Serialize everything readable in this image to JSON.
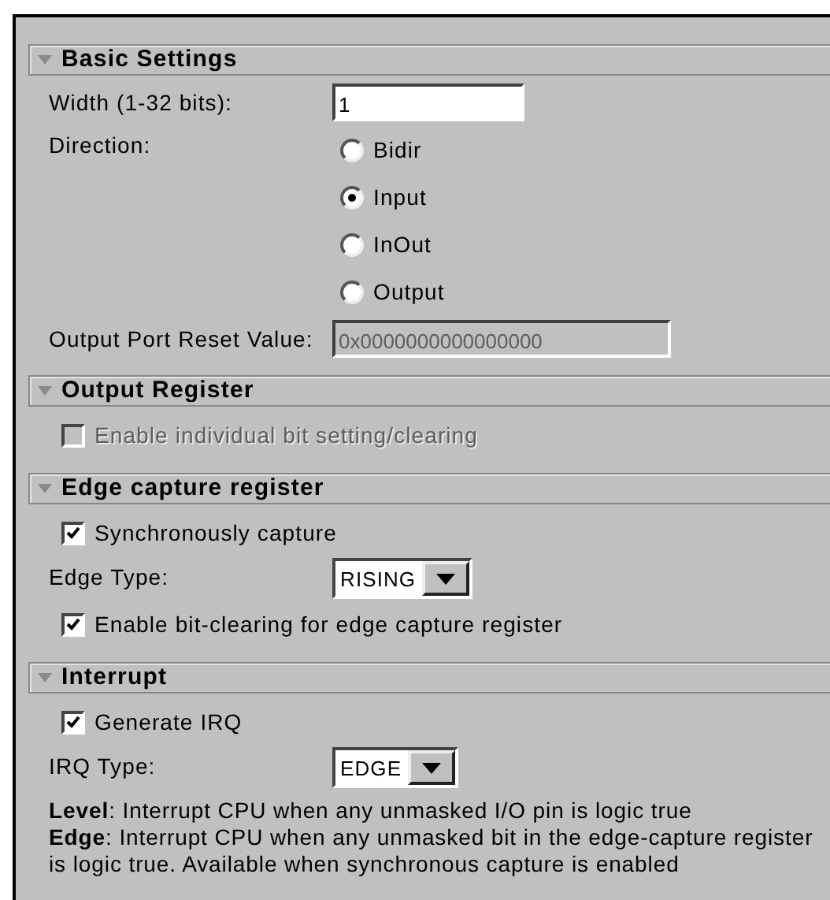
{
  "sections": [
    {
      "title": "Basic Settings",
      "expanded": true,
      "rows": [
        {
          "kind": "text",
          "label": "Width (1-32 bits):",
          "value": "1",
          "disabled": false
        },
        {
          "kind": "radio",
          "label": "Direction:",
          "options": [
            {
              "label": "Bidir",
              "selected": false
            },
            {
              "label": "Input",
              "selected": true
            },
            {
              "label": "InOut",
              "selected": false
            },
            {
              "label": "Output",
              "selected": false
            }
          ]
        },
        {
          "kind": "text",
          "label": "Output Port Reset Value:",
          "value": "0x0000000000000000",
          "disabled": true
        }
      ]
    },
    {
      "title": "Output Register",
      "expanded": true,
      "rows": [
        {
          "kind": "checkbox",
          "label": "Enable individual bit setting/clearing",
          "checked": false,
          "disabled": true
        }
      ]
    },
    {
      "title": "Edge capture register",
      "expanded": true,
      "rows": [
        {
          "kind": "checkbox",
          "label": "Synchronously capture",
          "checked": true,
          "disabled": false
        },
        {
          "kind": "select",
          "label": "Edge Type:",
          "value": "RISING"
        },
        {
          "kind": "checkbox",
          "label": "Enable bit-clearing for edge capture register",
          "checked": true,
          "disabled": false
        }
      ]
    },
    {
      "title": "Interrupt",
      "expanded": true,
      "rows": [
        {
          "kind": "checkbox",
          "label": "Generate IRQ",
          "checked": true,
          "disabled": false
        },
        {
          "kind": "select",
          "label": "IRQ Type:",
          "value": "EDGE"
        },
        {
          "kind": "note",
          "lines": [
            "**Level**: Interrupt CPU when any unmasked I/O pin is logic true",
            "**Edge**: Interrupt CPU when any unmasked bit in the edge-capture register is logic true. Available when synchronous capture is enabled"
          ]
        }
      ]
    }
  ]
}
